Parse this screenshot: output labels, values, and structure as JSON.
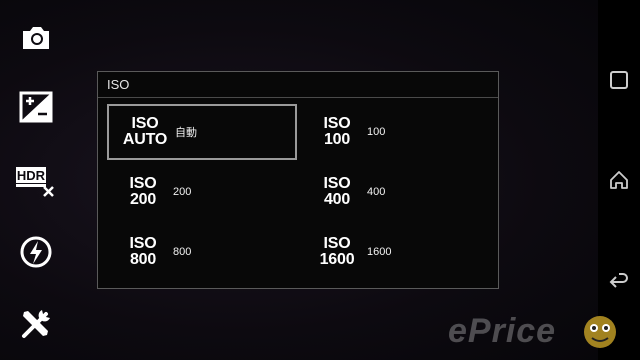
{
  "dialog": {
    "title": "ISO",
    "options": [
      {
        "big_line1": "ISO",
        "big_line2": "AUTO",
        "label": "自動",
        "selected": true
      },
      {
        "big_line1": "ISO",
        "big_line2": "100",
        "label": "100",
        "selected": false
      },
      {
        "big_line1": "ISO",
        "big_line2": "200",
        "label": "200",
        "selected": false
      },
      {
        "big_line1": "ISO",
        "big_line2": "400",
        "label": "400",
        "selected": false
      },
      {
        "big_line1": "ISO",
        "big_line2": "800",
        "label": "800",
        "selected": false
      },
      {
        "big_line1": "ISO",
        "big_line2": "1600",
        "label": "1600",
        "selected": false
      }
    ]
  },
  "sidebar": {
    "icons": [
      "camera-mode-icon",
      "exposure-compensation-icon",
      "hdr-off-icon",
      "flash-auto-icon",
      "settings-tools-icon"
    ],
    "hdr_text": "HDR"
  },
  "navbar": {
    "icons": [
      "recent-apps-icon",
      "home-icon",
      "back-icon"
    ]
  },
  "watermark": {
    "text": "ePrice"
  },
  "colors": {
    "dialog_border": "#5a5a5a",
    "selected_border": "#9a9a9a",
    "text": "#ffffff"
  }
}
